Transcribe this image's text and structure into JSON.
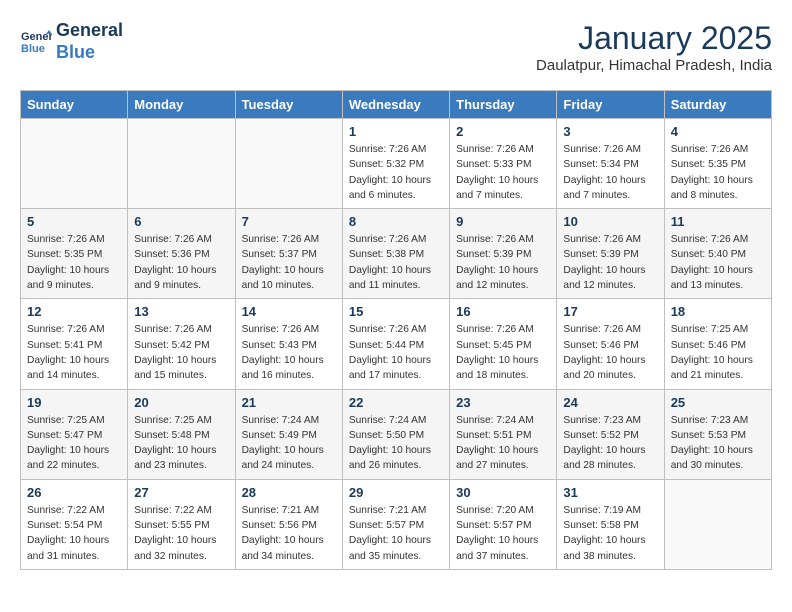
{
  "header": {
    "logo_line1": "General",
    "logo_line2": "Blue",
    "month_year": "January 2025",
    "location": "Daulatpur, Himachal Pradesh, India"
  },
  "weekdays": [
    "Sunday",
    "Monday",
    "Tuesday",
    "Wednesday",
    "Thursday",
    "Friday",
    "Saturday"
  ],
  "weeks": [
    [
      {
        "day": "",
        "sunrise": "",
        "sunset": "",
        "daylight": ""
      },
      {
        "day": "",
        "sunrise": "",
        "sunset": "",
        "daylight": ""
      },
      {
        "day": "",
        "sunrise": "",
        "sunset": "",
        "daylight": ""
      },
      {
        "day": "1",
        "sunrise": "Sunrise: 7:26 AM",
        "sunset": "Sunset: 5:32 PM",
        "daylight": "Daylight: 10 hours and 6 minutes."
      },
      {
        "day": "2",
        "sunrise": "Sunrise: 7:26 AM",
        "sunset": "Sunset: 5:33 PM",
        "daylight": "Daylight: 10 hours and 7 minutes."
      },
      {
        "day": "3",
        "sunrise": "Sunrise: 7:26 AM",
        "sunset": "Sunset: 5:34 PM",
        "daylight": "Daylight: 10 hours and 7 minutes."
      },
      {
        "day": "4",
        "sunrise": "Sunrise: 7:26 AM",
        "sunset": "Sunset: 5:35 PM",
        "daylight": "Daylight: 10 hours and 8 minutes."
      }
    ],
    [
      {
        "day": "5",
        "sunrise": "Sunrise: 7:26 AM",
        "sunset": "Sunset: 5:35 PM",
        "daylight": "Daylight: 10 hours and 9 minutes."
      },
      {
        "day": "6",
        "sunrise": "Sunrise: 7:26 AM",
        "sunset": "Sunset: 5:36 PM",
        "daylight": "Daylight: 10 hours and 9 minutes."
      },
      {
        "day": "7",
        "sunrise": "Sunrise: 7:26 AM",
        "sunset": "Sunset: 5:37 PM",
        "daylight": "Daylight: 10 hours and 10 minutes."
      },
      {
        "day": "8",
        "sunrise": "Sunrise: 7:26 AM",
        "sunset": "Sunset: 5:38 PM",
        "daylight": "Daylight: 10 hours and 11 minutes."
      },
      {
        "day": "9",
        "sunrise": "Sunrise: 7:26 AM",
        "sunset": "Sunset: 5:39 PM",
        "daylight": "Daylight: 10 hours and 12 minutes."
      },
      {
        "day": "10",
        "sunrise": "Sunrise: 7:26 AM",
        "sunset": "Sunset: 5:39 PM",
        "daylight": "Daylight: 10 hours and 12 minutes."
      },
      {
        "day": "11",
        "sunrise": "Sunrise: 7:26 AM",
        "sunset": "Sunset: 5:40 PM",
        "daylight": "Daylight: 10 hours and 13 minutes."
      }
    ],
    [
      {
        "day": "12",
        "sunrise": "Sunrise: 7:26 AM",
        "sunset": "Sunset: 5:41 PM",
        "daylight": "Daylight: 10 hours and 14 minutes."
      },
      {
        "day": "13",
        "sunrise": "Sunrise: 7:26 AM",
        "sunset": "Sunset: 5:42 PM",
        "daylight": "Daylight: 10 hours and 15 minutes."
      },
      {
        "day": "14",
        "sunrise": "Sunrise: 7:26 AM",
        "sunset": "Sunset: 5:43 PM",
        "daylight": "Daylight: 10 hours and 16 minutes."
      },
      {
        "day": "15",
        "sunrise": "Sunrise: 7:26 AM",
        "sunset": "Sunset: 5:44 PM",
        "daylight": "Daylight: 10 hours and 17 minutes."
      },
      {
        "day": "16",
        "sunrise": "Sunrise: 7:26 AM",
        "sunset": "Sunset: 5:45 PM",
        "daylight": "Daylight: 10 hours and 18 minutes."
      },
      {
        "day": "17",
        "sunrise": "Sunrise: 7:26 AM",
        "sunset": "Sunset: 5:46 PM",
        "daylight": "Daylight: 10 hours and 20 minutes."
      },
      {
        "day": "18",
        "sunrise": "Sunrise: 7:25 AM",
        "sunset": "Sunset: 5:46 PM",
        "daylight": "Daylight: 10 hours and 21 minutes."
      }
    ],
    [
      {
        "day": "19",
        "sunrise": "Sunrise: 7:25 AM",
        "sunset": "Sunset: 5:47 PM",
        "daylight": "Daylight: 10 hours and 22 minutes."
      },
      {
        "day": "20",
        "sunrise": "Sunrise: 7:25 AM",
        "sunset": "Sunset: 5:48 PM",
        "daylight": "Daylight: 10 hours and 23 minutes."
      },
      {
        "day": "21",
        "sunrise": "Sunrise: 7:24 AM",
        "sunset": "Sunset: 5:49 PM",
        "daylight": "Daylight: 10 hours and 24 minutes."
      },
      {
        "day": "22",
        "sunrise": "Sunrise: 7:24 AM",
        "sunset": "Sunset: 5:50 PM",
        "daylight": "Daylight: 10 hours and 26 minutes."
      },
      {
        "day": "23",
        "sunrise": "Sunrise: 7:24 AM",
        "sunset": "Sunset: 5:51 PM",
        "daylight": "Daylight: 10 hours and 27 minutes."
      },
      {
        "day": "24",
        "sunrise": "Sunrise: 7:23 AM",
        "sunset": "Sunset: 5:52 PM",
        "daylight": "Daylight: 10 hours and 28 minutes."
      },
      {
        "day": "25",
        "sunrise": "Sunrise: 7:23 AM",
        "sunset": "Sunset: 5:53 PM",
        "daylight": "Daylight: 10 hours and 30 minutes."
      }
    ],
    [
      {
        "day": "26",
        "sunrise": "Sunrise: 7:22 AM",
        "sunset": "Sunset: 5:54 PM",
        "daylight": "Daylight: 10 hours and 31 minutes."
      },
      {
        "day": "27",
        "sunrise": "Sunrise: 7:22 AM",
        "sunset": "Sunset: 5:55 PM",
        "daylight": "Daylight: 10 hours and 32 minutes."
      },
      {
        "day": "28",
        "sunrise": "Sunrise: 7:21 AM",
        "sunset": "Sunset: 5:56 PM",
        "daylight": "Daylight: 10 hours and 34 minutes."
      },
      {
        "day": "29",
        "sunrise": "Sunrise: 7:21 AM",
        "sunset": "Sunset: 5:57 PM",
        "daylight": "Daylight: 10 hours and 35 minutes."
      },
      {
        "day": "30",
        "sunrise": "Sunrise: 7:20 AM",
        "sunset": "Sunset: 5:57 PM",
        "daylight": "Daylight: 10 hours and 37 minutes."
      },
      {
        "day": "31",
        "sunrise": "Sunrise: 7:19 AM",
        "sunset": "Sunset: 5:58 PM",
        "daylight": "Daylight: 10 hours and 38 minutes."
      },
      {
        "day": "",
        "sunrise": "",
        "sunset": "",
        "daylight": ""
      }
    ]
  ]
}
